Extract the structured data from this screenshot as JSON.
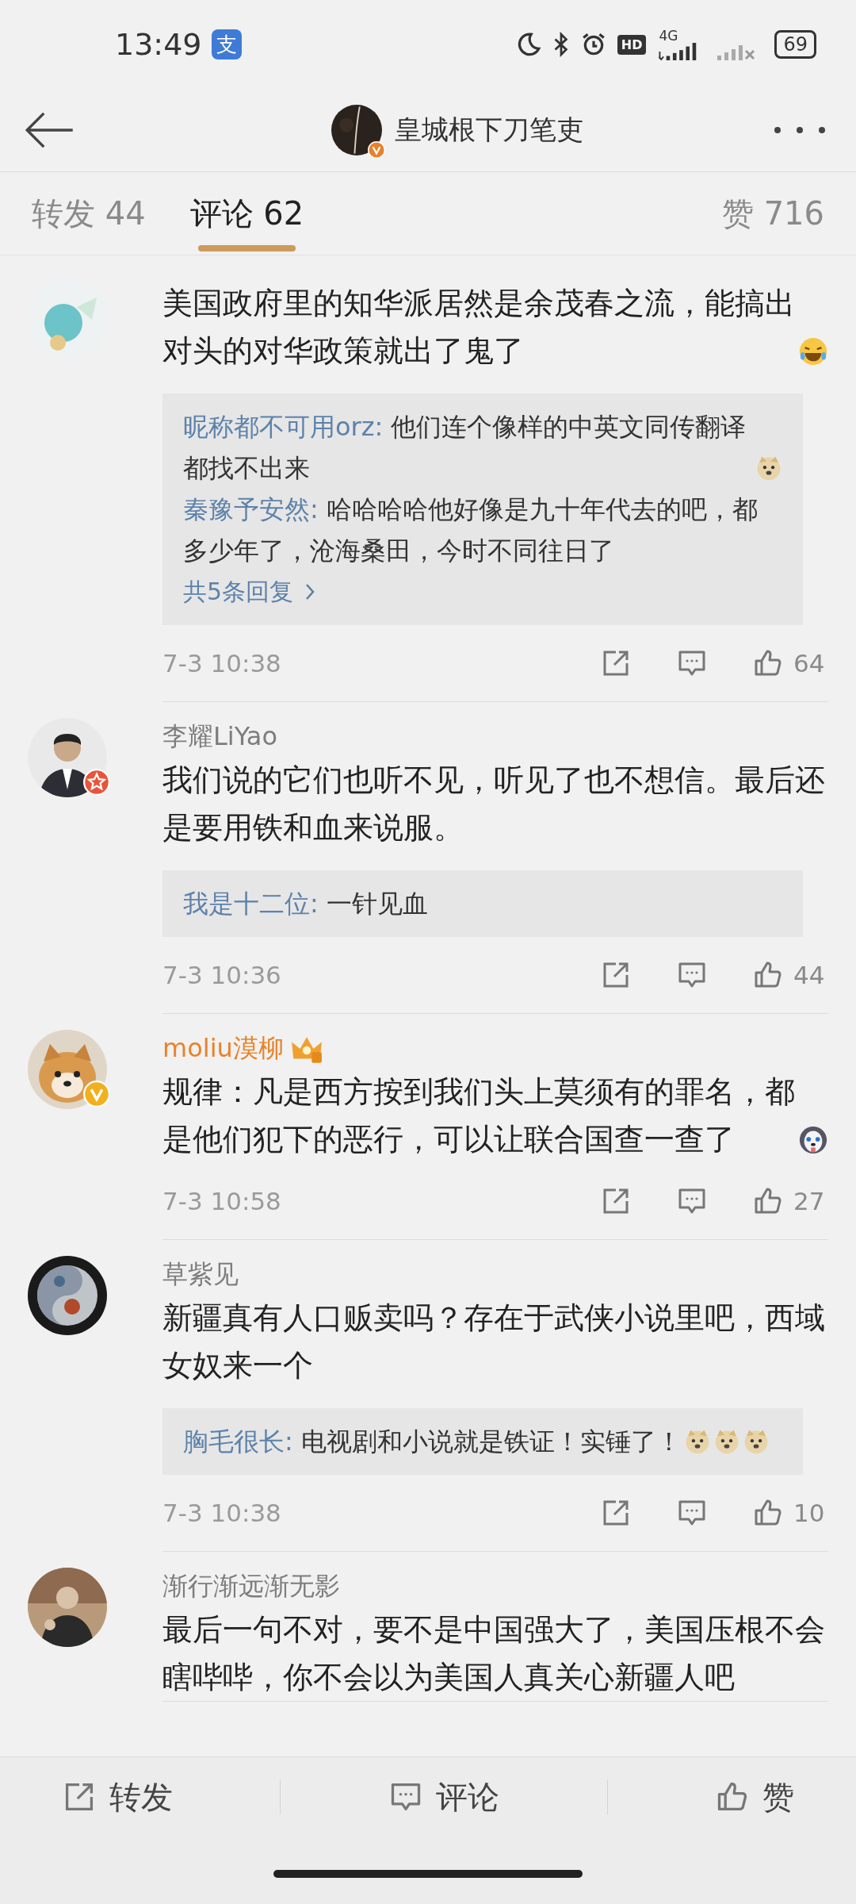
{
  "status_bar": {
    "time": "13:49",
    "app_badge": "支",
    "hd": "HD",
    "network": "4G",
    "battery": "69"
  },
  "header": {
    "title": "皇城根下刀笔吏",
    "verified": true
  },
  "tabs": [
    {
      "label": "转发 44",
      "selected": false
    },
    {
      "label": "评论 62",
      "selected": true
    },
    {
      "label": "赞 716",
      "selected": false
    }
  ],
  "comments": [
    {
      "text": "美国政府里的知华派居然是余茂春之流，能搞出对头的对华政策就出了鬼了",
      "emojis": [
        {
          "kind": "laugh"
        }
      ],
      "replies": [
        {
          "author": "昵称都不可用orz:",
          "text": "他们连个像样的中英文同传翻译都找不出来",
          "emojis": [
            {
              "kind": "doge"
            }
          ]
        },
        {
          "author": "秦豫予安然:",
          "text": "哈哈哈哈他好像是九十年代去的吧，都多少年了，沧海桑田，今时不同往日了"
        }
      ],
      "more_replies": "共5条回复",
      "time": "7-3 10:38",
      "likes": "64"
    },
    {
      "author": "李耀LiYao",
      "star_member": true,
      "vip": false,
      "text": "我们说的它们也听不见，听见了也不想信。最后还是要用铁和血来说服。",
      "replies": [
        {
          "author": "我是十二位:",
          "text": "一针见血"
        }
      ],
      "time": "7-3 10:36",
      "likes": "44"
    },
    {
      "author": "moliu漠柳",
      "verified": true,
      "vip": true,
      "text": "规律：凡是西方按到我们头上莫须有的罪名，都是他们犯下的恶行，可以让联合国查一查了",
      "emojis": [
        {
          "kind": "husky"
        }
      ],
      "time": "7-3 10:58",
      "likes": "27"
    },
    {
      "author": "草紫见",
      "vip": false,
      "text": "新疆真有人口贩卖吗？存在于武侠小说里吧，西域女奴来一个",
      "replies": [
        {
          "author": "胸毛很长:",
          "text": "电视剧和小说就是铁证！实锤了！",
          "emojis": [
            {
              "kind": "doge"
            },
            {
              "kind": "doge"
            },
            {
              "kind": "doge"
            }
          ]
        }
      ],
      "time": "7-3 10:38",
      "likes": "10"
    },
    {
      "author": "渐行渐远渐无影",
      "vip": false,
      "text": "最后一句不对，要不是中国强大了，美国压根不会瞎哔哔，你不会以为美国人真关心新疆人吧"
    }
  ],
  "bottom_bar": [
    {
      "kind": "share",
      "label": "转发"
    },
    {
      "kind": "comment",
      "label": "评论"
    },
    {
      "kind": "like",
      "label": "赞"
    }
  ]
}
